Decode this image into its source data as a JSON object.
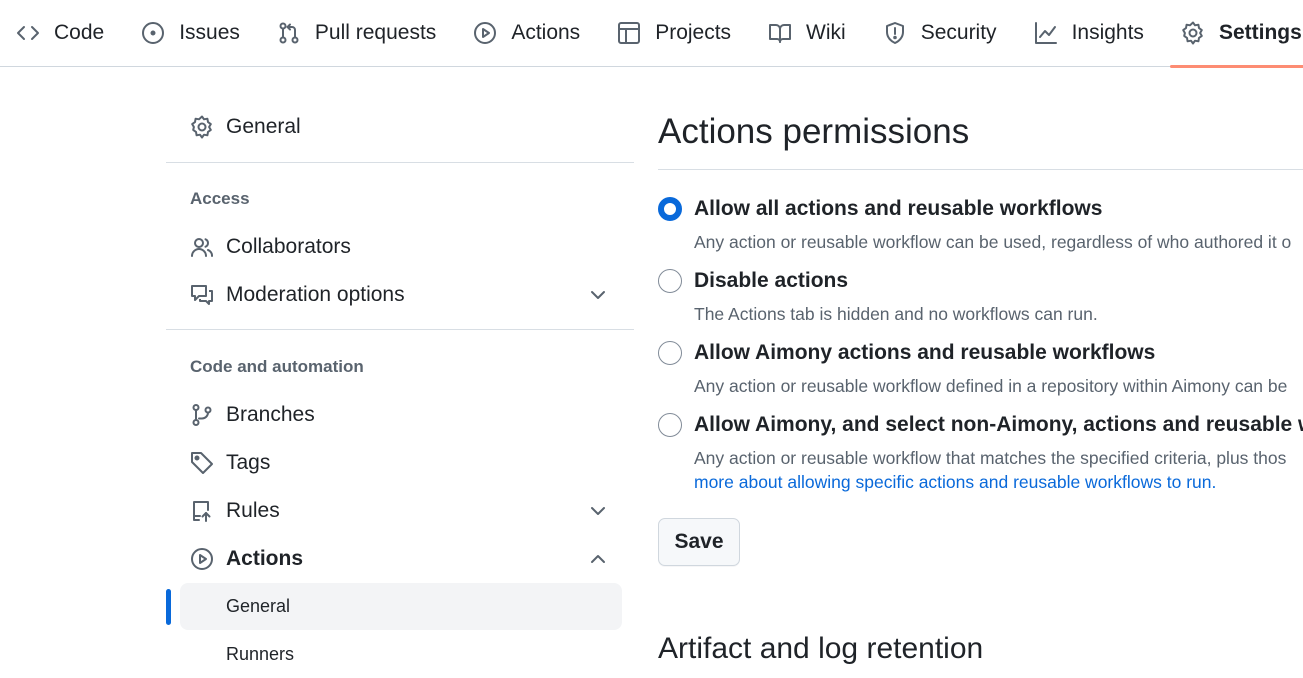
{
  "topnav": {
    "tabs": [
      {
        "label": "Code",
        "icon": "code-icon"
      },
      {
        "label": "Issues",
        "icon": "issue-opened-icon"
      },
      {
        "label": "Pull requests",
        "icon": "git-pull-request-icon"
      },
      {
        "label": "Actions",
        "icon": "play-icon"
      },
      {
        "label": "Projects",
        "icon": "table-icon"
      },
      {
        "label": "Wiki",
        "icon": "book-icon"
      },
      {
        "label": "Security",
        "icon": "shield-icon"
      },
      {
        "label": "Insights",
        "icon": "graph-icon"
      },
      {
        "label": "Settings",
        "icon": "gear-icon",
        "selected": true
      }
    ],
    "underline_color": "#fd8c73"
  },
  "sidebar": {
    "general": "General",
    "access_heading": "Access",
    "collaborators": "Collaborators",
    "moderation": "Moderation options",
    "code_heading": "Code and automation",
    "branches": "Branches",
    "tags": "Tags",
    "rules": "Rules",
    "actions": "Actions",
    "actions_general": "General",
    "actions_runners": "Runners",
    "active_marker_color": "#0969da"
  },
  "main": {
    "title": "Actions permissions",
    "options": [
      {
        "label": "Allow all actions and reusable workflows",
        "desc": "Any action or reusable workflow can be used, regardless of who authored it o",
        "checked": true
      },
      {
        "label": "Disable actions",
        "desc": "The Actions tab is hidden and no workflows can run.",
        "checked": false
      },
      {
        "label": "Allow Aimony actions and reusable workflows",
        "desc": "Any action or reusable workflow defined in a repository within Aimony can be",
        "checked": false
      },
      {
        "label": "Allow Aimony, and select non-Aimony, actions and reusable wor",
        "desc": "Any action or reusable workflow that matches the specified criteria, plus thos",
        "link": "more about allowing specific actions and reusable workflows to run.",
        "checked": false
      }
    ],
    "save_label": "Save",
    "section2_title": "Artifact and log retention",
    "accent_color": "#0969da"
  }
}
